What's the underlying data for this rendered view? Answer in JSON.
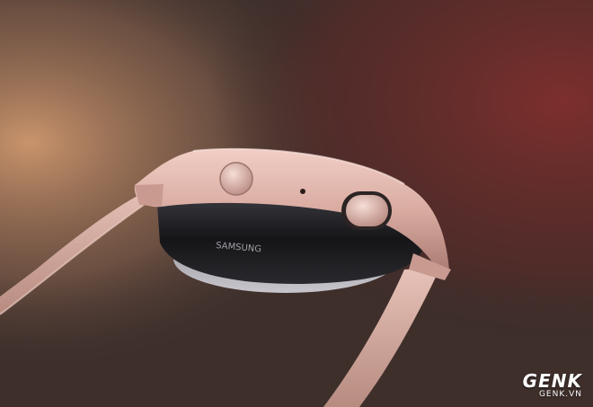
{
  "photo": {
    "subject": "smartwatch-side-view",
    "colors": {
      "background_left": "#b98a66",
      "background_right": "#6a2c2a",
      "case": "#d8aba2",
      "strap": "#d9b0a6",
      "glass": "#1e1e22"
    }
  },
  "watch": {
    "engraving": "SAMSUNG"
  },
  "watermark": {
    "logo": "GENK",
    "site": "GENK.VN"
  }
}
